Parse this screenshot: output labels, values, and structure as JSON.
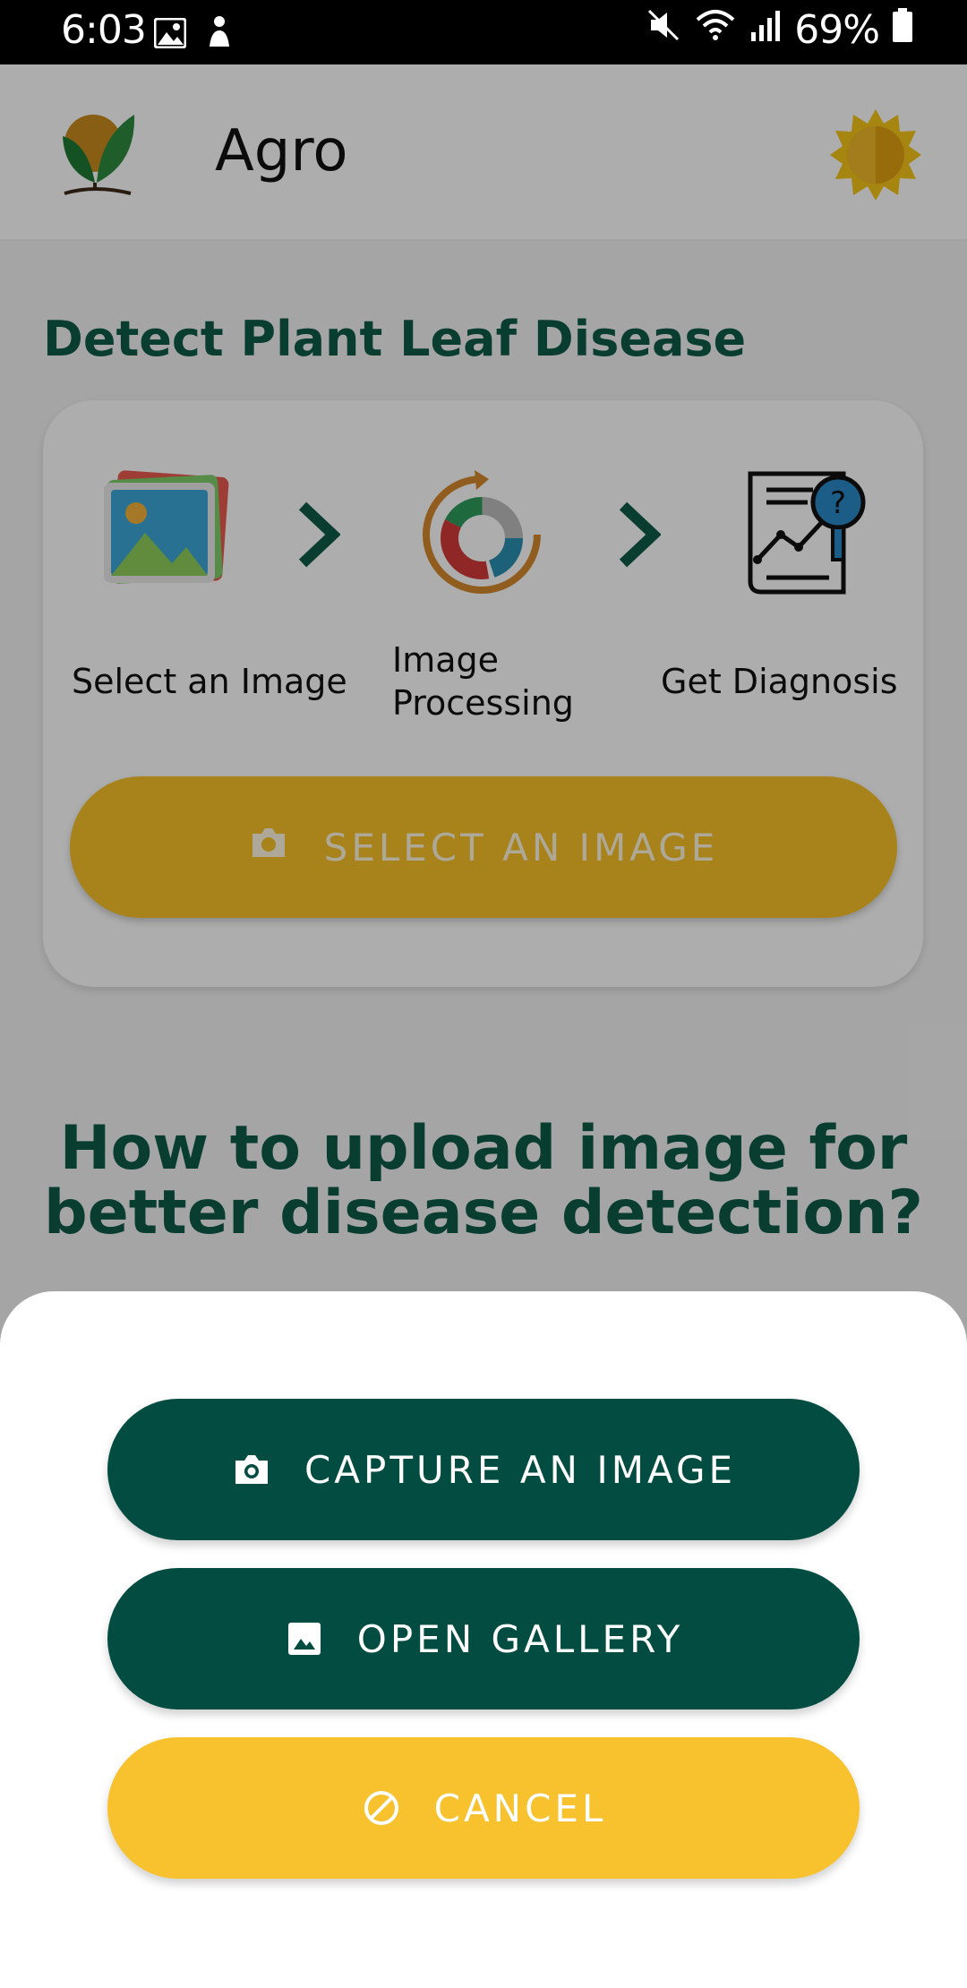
{
  "status_bar": {
    "time": "6:03",
    "battery": "69%",
    "icons_left": [
      "image-notification-icon",
      "app-notification-icon"
    ],
    "icons_right": [
      "mute-vibrate-icon",
      "wifi-icon",
      "signal-icon",
      "battery-icon"
    ]
  },
  "appbar": {
    "title": "Agro",
    "logo_icon": "plant-sprout-logo",
    "theme_icon": "sun-icon"
  },
  "main": {
    "heading": "Detect Plant Leaf Disease",
    "steps": [
      {
        "label": "Select an Image",
        "icon": "gallery-image-icon"
      },
      {
        "label": "Image Processing",
        "icon": "processing-ring-icon"
      },
      {
        "label": "Get Diagnosis",
        "icon": "diagnosis-report-icon"
      }
    ],
    "select_button": "SELECT AN IMAGE",
    "howto_line1": "How to upload image for",
    "howto_line2": "better disease detection?"
  },
  "sheet": {
    "capture_label": "CAPTURE AN IMAGE",
    "gallery_label": "OPEN GALLERY",
    "cancel_label": "CANCEL"
  },
  "colors": {
    "primary_green": "#024c41",
    "heading_green": "#0e5a47",
    "accent_yellow": "#f8c22e",
    "scrim": "rgba(0,0,0,0.32)"
  }
}
